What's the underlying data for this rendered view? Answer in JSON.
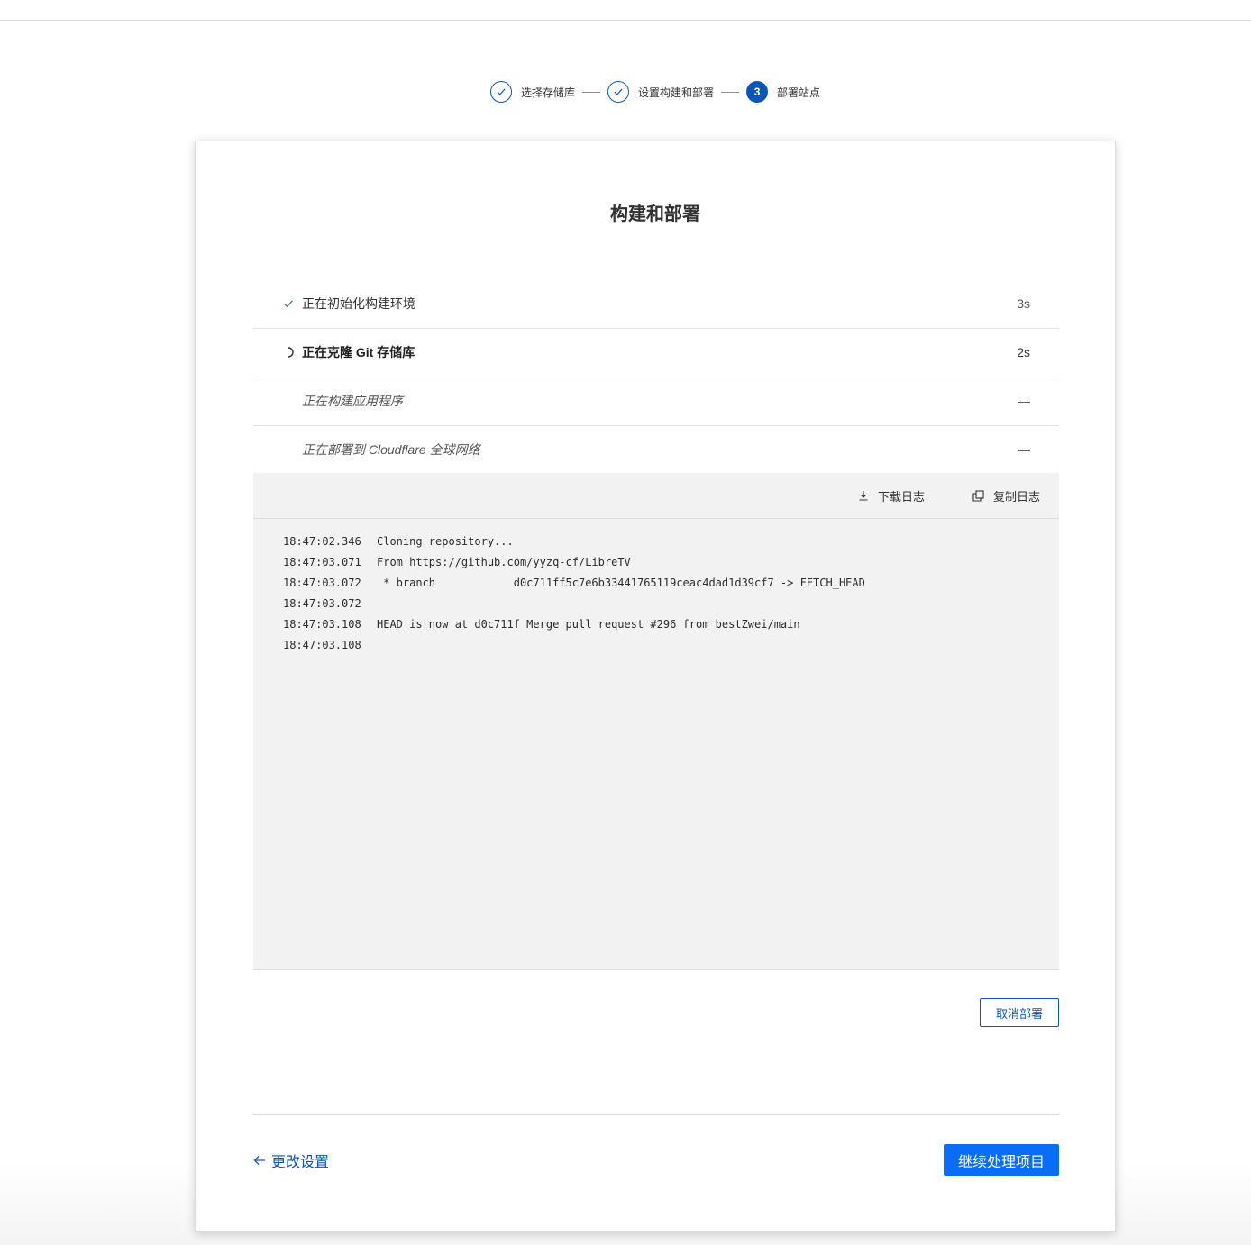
{
  "stepper": {
    "steps": [
      {
        "label": "选择存储库",
        "state": "done",
        "icon": "check-icon"
      },
      {
        "label": "设置构建和部署",
        "state": "done",
        "icon": "check-icon"
      },
      {
        "label": "部署站点",
        "state": "active",
        "number": "3"
      }
    ]
  },
  "card": {
    "title": "构建和部署"
  },
  "stages": [
    {
      "name": "正在初始化构建环境",
      "duration": "3s",
      "status": "done",
      "icon": "check-icon"
    },
    {
      "name": "正在克隆 Git 存储库",
      "duration": "2s",
      "status": "running",
      "icon": "spinner-icon"
    },
    {
      "name": "正在构建应用程序",
      "duration": "—",
      "status": "pending"
    },
    {
      "name": "正在部署到 Cloudflare 全球网络",
      "duration": "—",
      "status": "pending"
    }
  ],
  "log": {
    "download_label": "下载日志",
    "copy_label": "复制日志",
    "lines": [
      {
        "time": "18:47:02.346",
        "text": "Cloning repository..."
      },
      {
        "time": "18:47:03.071",
        "text": "From https://github.com/yyzq-cf/LibreTV"
      },
      {
        "time": "18:47:03.072",
        "text": " * branch            d0c711ff5c7e6b33441765119ceac4dad1d39cf7 -> FETCH_HEAD"
      },
      {
        "time": "18:47:03.072",
        "text": ""
      },
      {
        "time": "18:47:03.108",
        "text": "HEAD is now at d0c711f Merge pull request #296 from bestZwei/main"
      },
      {
        "time": "18:47:03.108",
        "text": ""
      }
    ]
  },
  "actions": {
    "cancel_label": "取消部署",
    "back_label": "更改设置",
    "continue_label": "继续处理项目"
  },
  "colors": {
    "accent": "#0b56b5",
    "primary": "#0a6df5",
    "success": "#2f8a3f"
  }
}
